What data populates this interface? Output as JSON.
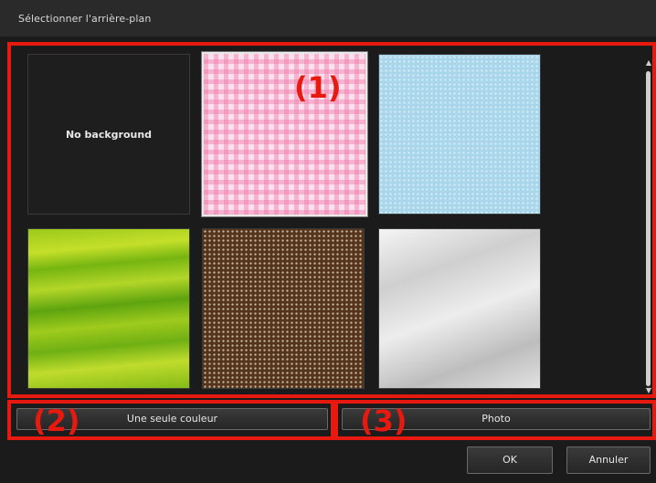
{
  "window": {
    "title": "Sélectionner l'arrière-plan"
  },
  "backgrounds": [
    {
      "label": "No background",
      "kind": "none"
    },
    {
      "label": "",
      "kind": "pink-gingham",
      "selected": true
    },
    {
      "label": "",
      "kind": "blue-dots"
    },
    {
      "label": "",
      "kind": "green-waves"
    },
    {
      "label": "",
      "kind": "brown-dots"
    },
    {
      "label": "",
      "kind": "brushed-metal"
    }
  ],
  "buttons": {
    "single_color": "Une seule couleur",
    "photo": "Photo",
    "ok": "OK",
    "cancel": "Annuler"
  },
  "callouts": {
    "c1": "(1)",
    "c2": "(2)",
    "c3": "(3)"
  },
  "icons": {
    "scroll_up": "scroll-up-arrow-icon",
    "scroll_down": "scroll-down-arrow-icon"
  },
  "colors": {
    "highlight": "#e8190f",
    "selected_border": "#e9e9e9"
  }
}
